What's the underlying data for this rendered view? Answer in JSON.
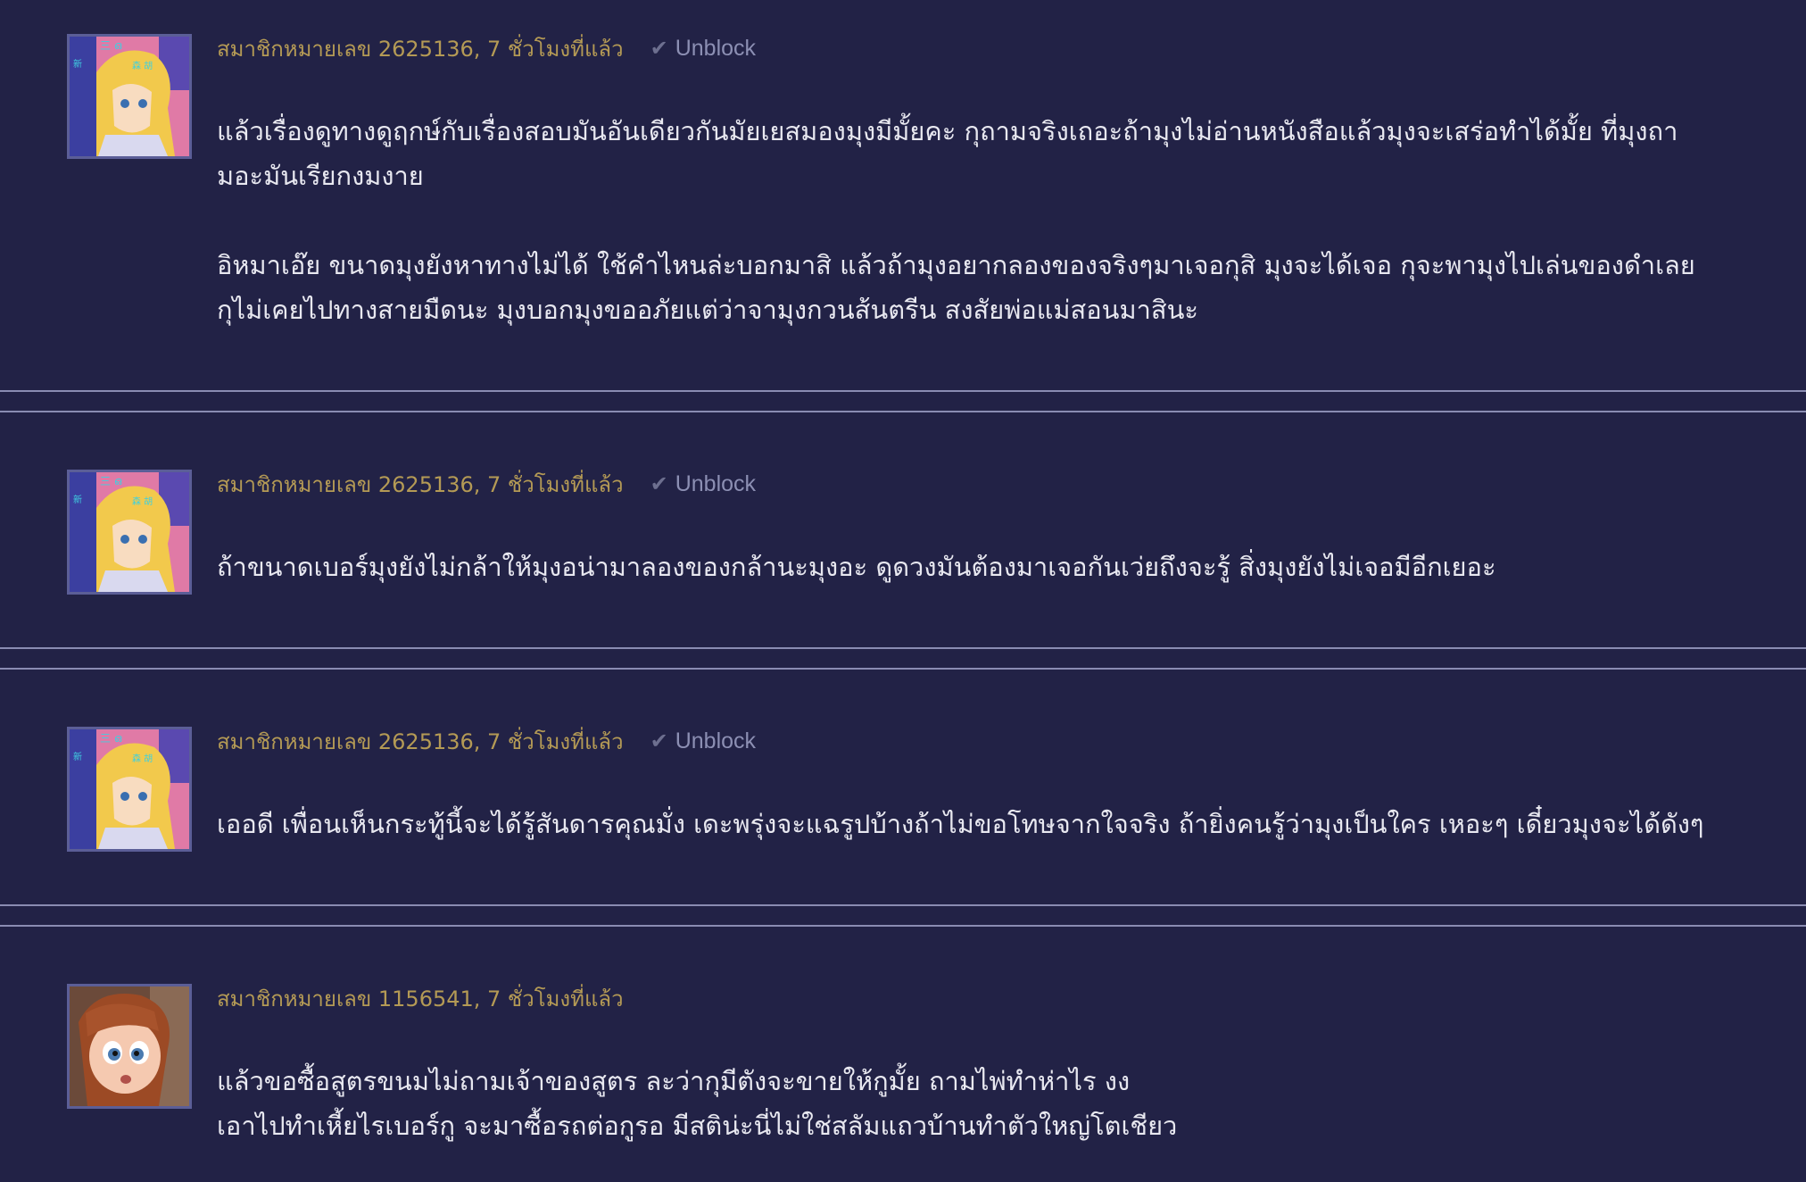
{
  "unblock_label": "Unblock",
  "comments": [
    {
      "author": "สมาชิกหมายเลข 2625136, 7 ชั่วโมงที่แล้ว",
      "avatar": "anime-avatar",
      "paragraphs": [
        [
          "แล้วเรื่องดูทางดูฤกษ์กับเรื่องสอบมันอันเดียวกันมัยเยสมองมุงมีมั้ยคะ กุถามจริงเถอะถ้ามุงไม่อ่านหนังสือแล้วมุงจะเสร่อทำได้มั้ย ที่มุงถา",
          "มอะมันเรียกงมงาย"
        ],
        [
          "อิหมาเอ๊ย ขนาดมุงยังหาทางไม่ได้ ใช้คำไหนล่ะบอกมาสิ แล้วถ้ามุงอยากลองของจริงๆมาเจอกุสิ มุงจะได้เจอ กุจะพามุงไปเล่นของดำเลย",
          "กุไม่เคยไปทางสายมืดนะ มุงบอกมุงขออภัยแต่ว่าจามุงกวนส้นตรีน สงสัยพ่อแม่สอนมาสินะ"
        ]
      ]
    },
    {
      "author": "สมาชิกหมายเลข 2625136, 7 ชั่วโมงที่แล้ว",
      "avatar": "anime-avatar",
      "paragraphs": [
        [
          "ถ้าขนาดเบอร์มุงยังไม่กล้าให้มุงอน่ามาลองของกล้านะมุงอะ ดูดวงมันต้องมาเจอกันเว่ยถึงจะรู้ สิ่งมุงยังไม่เจอมีอีกเยอะ"
        ]
      ]
    },
    {
      "author": "สมาชิกหมายเลข 2625136, 7 ชั่วโมงที่แล้ว",
      "avatar": "anime-avatar",
      "paragraphs": [
        [
          "เออดี เพื่อนเห็นกระทู้นี้จะได้รู้สันดารคุณมั่ง เดะพรุ่งจะแฉรูปบ้างถ้าไม่ขอโทษจากใจจริง ถ้ายิ่งคนรู้ว่ามุงเป็นใคร เหอะๆ เดี๋ยวมุงจะได้ดังๆ"
        ]
      ]
    },
    {
      "author": "สมาชิกหมายเลข 1156541, 7 ชั่วโมงที่แล้ว",
      "avatar": "cartoon-girl-avatar",
      "paragraphs": [
        [
          "แล้วขอซื้อสูตรขนมไม่ถามเจ้าของสูตร ละว่ากุมีตังจะขายให้กูมั้ย ถามไพ่ทำห่าไร งง",
          "เอาไปทำเหี้ยไรเบอร์กู จะมาซื้อรถต่อกูรอ มีสติน่ะนี่ไม่ใช่สลัมแถวบ้านทำตัวใหญ่โตเชียว"
        ]
      ]
    }
  ]
}
